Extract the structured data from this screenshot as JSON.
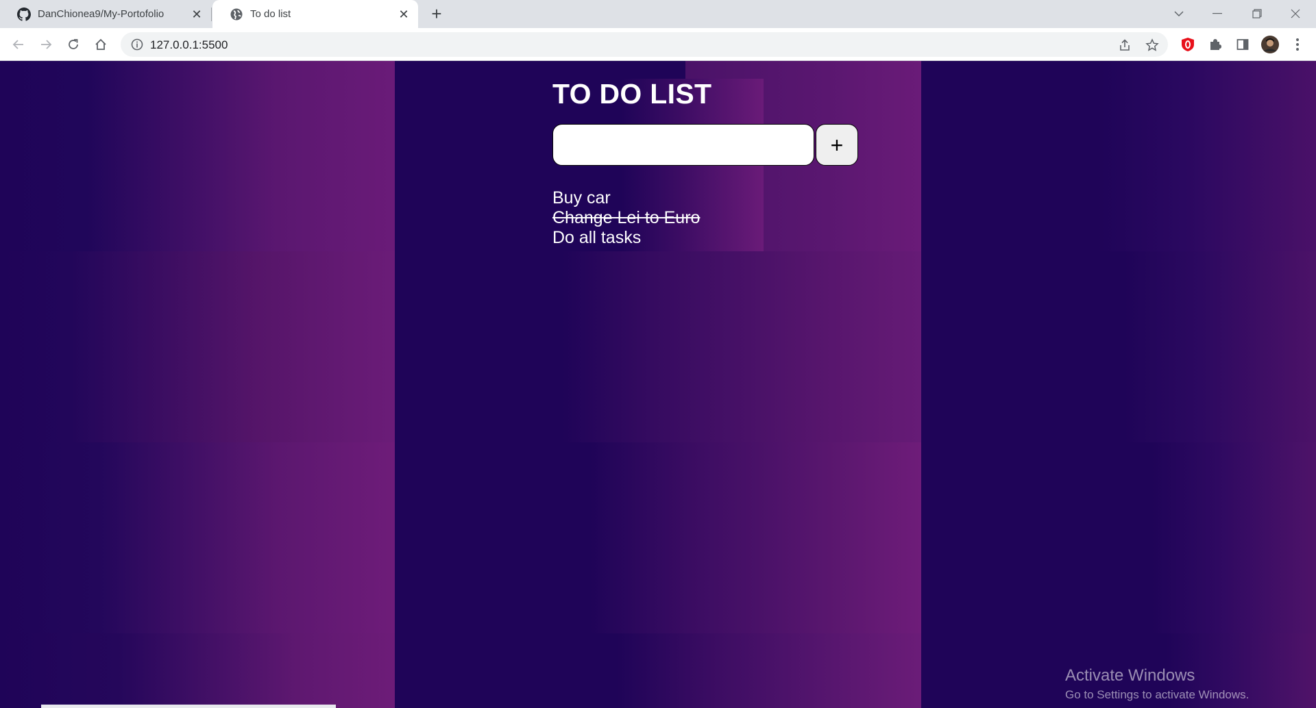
{
  "browser": {
    "tabs": [
      {
        "title": "DanChionea9/My-Portofolio",
        "icon": "github-icon",
        "active": false
      },
      {
        "title": "To do list",
        "icon": "globe-icon",
        "active": true
      }
    ],
    "address": "127.0.0.1:5500"
  },
  "app": {
    "title": "TO DO LIST",
    "input_value": "",
    "add_label": "+",
    "tasks": [
      {
        "text": "Buy car",
        "done": false
      },
      {
        "text": "Change Lei to Euro",
        "done": true
      },
      {
        "text": "Do all tasks",
        "done": false
      }
    ]
  },
  "watermark": {
    "line1": "Activate Windows",
    "line2": "Go to Settings to activate Windows."
  },
  "colors": {
    "background": "#1f0458",
    "accent": "#6a1b78",
    "text": "#ffffff"
  }
}
